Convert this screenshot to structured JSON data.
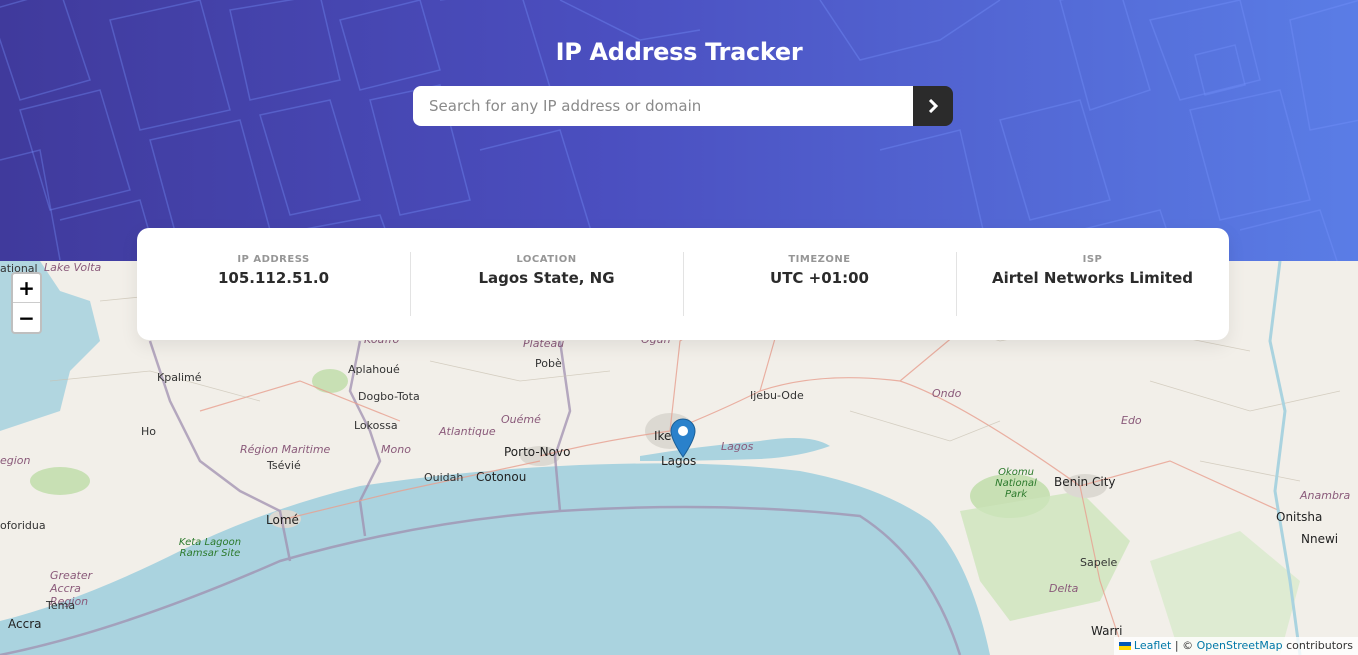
{
  "header": {
    "title": "IP Address Tracker",
    "search_placeholder": "Search for any IP address or domain",
    "search_value": "",
    "submit_icon": "chevron-right-icon"
  },
  "info": [
    {
      "label": "IP ADDRESS",
      "value": "105.112.51.0"
    },
    {
      "label": "LOCATION",
      "value": "Lagos State, NG"
    },
    {
      "label": "TIMEZONE",
      "value": "UTC +01:00"
    },
    {
      "label": "ISP",
      "value": "Airtel Networks Limited"
    }
  ],
  "map": {
    "zoom_in": "+",
    "zoom_out": "−",
    "marker_icon": "map-pin-icon",
    "labels": {
      "lake_volta": "Lake Volta",
      "ational": "ational",
      "kpalime": "Kpalimé",
      "aplahoue": "Aplahoué",
      "dogbo": "Dogbo-Tota",
      "lokossa": "Lokossa",
      "ho": "Ho",
      "region_maritime": "Région Maritime",
      "tsevie": "Tsévié",
      "atlantique": "Atlantique",
      "mono": "Mono",
      "oueme": "Ouémé",
      "plateau": "Plateau",
      "pobe": "Pobè",
      "ogun": "Ogun",
      "kouffo": "Kouffo",
      "ijebu": "Ijebu-Ode",
      "ondo": "Ondo",
      "edo": "Edo",
      "porto_novo": "Porto-Novo",
      "ouidah": "Ouidah",
      "cotonou": "Cotonou",
      "ike": "Ike",
      "lagos": "Lagos",
      "lagos_lagoon": "Lagos",
      "lome": "Lomé",
      "keta": "Keta Lagoon Ramsar Site",
      "greater_accra": "Greater Accra Region",
      "tema": "Tema",
      "accra": "Accra",
      "oforidua": "oforidua",
      "egion": "egion",
      "okomu": "Okomu National Park",
      "benin_city": "Benin City",
      "sapele": "Sapele",
      "delta": "Delta",
      "warri": "Warri",
      "onitsha": "Onitsha",
      "nnewi": "Nnewi",
      "anambra": "Anambra"
    },
    "attribution": {
      "leaflet": "Leaflet",
      "sep": " | © ",
      "osm": "OpenStreetMap",
      "contributors": " contributors"
    }
  },
  "colors": {
    "gradient_start": "#403a9c",
    "gradient_end": "#5a7de6",
    "button": "#2b2b2b",
    "sea": "#aad3df",
    "land": "#f2efe9",
    "marker": "#2a81cb"
  }
}
